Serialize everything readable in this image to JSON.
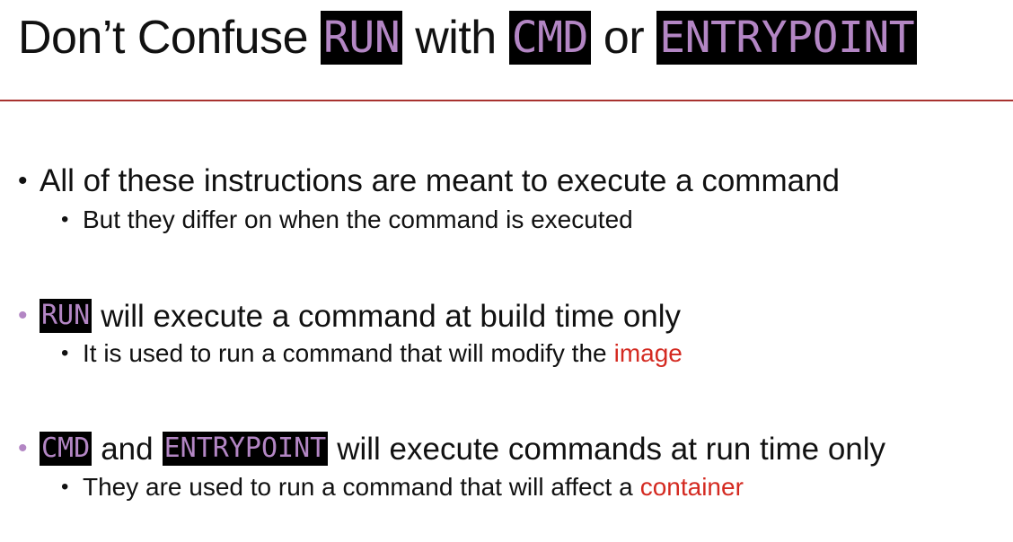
{
  "title": {
    "part1": "Don’t Confuse",
    "code1": "RUN",
    "part2": "with",
    "code2": "CMD",
    "part3": "or",
    "code3": "ENTRYPOINT"
  },
  "bullets": [
    {
      "text": "All of these instructions are meant to execute a command",
      "sub": "But they differ on when the command is executed"
    },
    {
      "code": "RUN",
      "text": "will execute a command at build time only",
      "sub": "It is used to run a command that will modify the",
      "sub_accent": "image"
    },
    {
      "code1": "CMD",
      "mid": "and",
      "code2": "ENTRYPOINT",
      "text": "will execute commands at run time only",
      "sub": "They are used to run a command that will affect a",
      "sub_accent": "container"
    }
  ],
  "colors": {
    "accent_purple": "#b386c4",
    "accent_red": "#d42a21",
    "rule": "#a8322f"
  }
}
